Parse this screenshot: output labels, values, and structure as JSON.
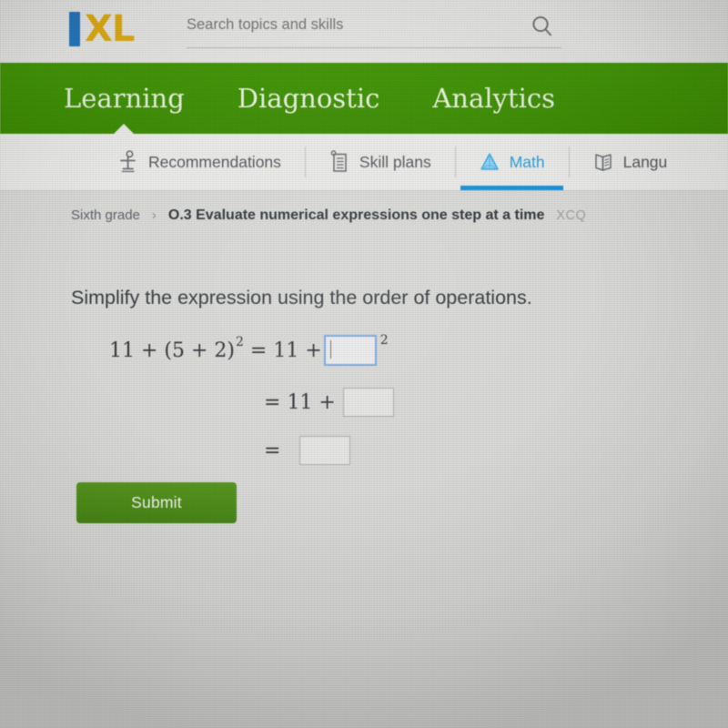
{
  "app": {
    "name": "IXL",
    "logo_letter_left": "I",
    "logo_letters_right": "XL",
    "brand_blue": "#2878bd",
    "brand_gold": "#ddab14",
    "brand_green": "#409006",
    "accent_blue": "#1b8fd4",
    "submit_green": "#4e8d1b"
  },
  "search": {
    "placeholder": "Search topics and skills",
    "value": "",
    "icon": "search-icon"
  },
  "primary_nav": {
    "items": [
      {
        "label": "Learning",
        "active": true
      },
      {
        "label": "Diagnostic",
        "active": false
      },
      {
        "label": "Analytics",
        "active": false
      }
    ]
  },
  "tabs": [
    {
      "label": "Recommendations",
      "icon": "recommendations-icon",
      "active": false
    },
    {
      "label": "Skill plans",
      "icon": "skill-plans-icon",
      "active": false
    },
    {
      "label": "Math",
      "icon": "math-pyramid-icon",
      "active": true
    },
    {
      "label": "Langu",
      "icon": "language-arts-book-icon",
      "active": false
    }
  ],
  "breadcrumb": {
    "grade": "Sixth grade",
    "separator": "›",
    "skill": "O.3 Evaluate numerical expressions one step at a time",
    "skill_code": "XCQ"
  },
  "question": {
    "prompt": "Simplify the expression using the order of operations.",
    "lines": [
      {
        "left_expression": "11 + (5 + 2)",
        "left_exponent": "2",
        "equals": "=",
        "right_prefix": "11 +",
        "input_value": "",
        "input_focused": true,
        "input_exponent": "2"
      },
      {
        "equals": "=",
        "right_prefix": "11 +",
        "input_value": "",
        "input_focused": false
      },
      {
        "equals": "=",
        "right_prefix": "",
        "input_value": "",
        "input_focused": false
      }
    ]
  },
  "actions": {
    "submit_label": "Submit"
  }
}
